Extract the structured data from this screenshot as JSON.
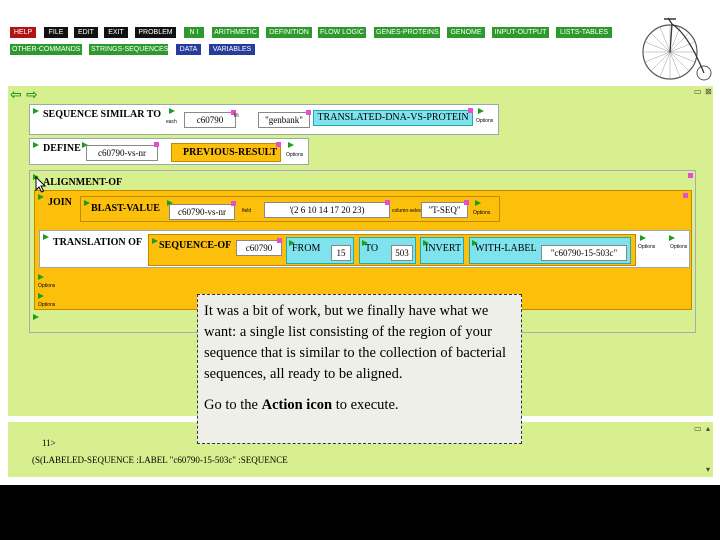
{
  "menu": {
    "row1": [
      {
        "label": "HELP",
        "color": "red"
      },
      {
        "label": "FILE",
        "color": "blk"
      },
      {
        "label": "EDIT",
        "color": "blk"
      },
      {
        "label": "EXIT",
        "color": "blk"
      },
      {
        "label": "PROBLEM",
        "color": "blk"
      },
      {
        "label": "N I",
        "color": "grn"
      },
      {
        "label": "ARITHMETIC",
        "color": "grn"
      },
      {
        "label": "DEFINITION",
        "color": "grn"
      },
      {
        "label": "FLOW LOGIC",
        "color": "grn"
      },
      {
        "label": "GENES-PROTEINS",
        "color": "grn"
      },
      {
        "label": "GENOME",
        "color": "grn"
      },
      {
        "label": "INPUT-OUTPUT",
        "color": "grn"
      },
      {
        "label": "LISTS-TABLES",
        "color": "grn"
      }
    ],
    "row2": [
      {
        "label": "OTHER-COMMANDS",
        "color": "grn"
      },
      {
        "label": "STRINGS-SEQUENCES",
        "color": "grn"
      },
      {
        "label": "DATA",
        "color": "blu"
      },
      {
        "label": "VARIABLES",
        "color": "blu"
      }
    ]
  },
  "workspace": {
    "seq_similar": {
      "keyword": "SEQUENCE SIMILAR TO",
      "arg1": "c60790",
      "label_each": "each",
      "label_in": "in",
      "arg2": "\"genbank\"",
      "arg3": "TRANSLATED-DNA-VS-PROTEIN",
      "options": "Options"
    },
    "define": {
      "keyword": "DEFINE",
      "arg1": "c60790-vs-nr",
      "arg2": "PREVIOUS-RESULT",
      "options": "Options"
    },
    "alignment": {
      "keyword": "ALIGNMENT-OF",
      "join": {
        "keyword": "JOIN",
        "blast_keyword": "BLAST-VALUE",
        "blast_arg": "c60790-vs-nr",
        "label_field": "field",
        "list_arg": "'(2 6 10 14 17 20 23)",
        "label_column": "column-selected",
        "tseq_arg": "\"T-SEQ\"",
        "options": "Options"
      },
      "translation": {
        "keyword": "TRANSLATION OF",
        "seqof_keyword": "SEQUENCE-OF",
        "seq_arg": "c60790",
        "from_label": "FROM",
        "from_val": "15",
        "to_label": "TO",
        "to_val": "503",
        "invert_label": "INVERT",
        "withlabel_label": "WITH-LABEL",
        "label_val": "\"c60790-15-503c\"",
        "options": "Options"
      },
      "options1": "Options",
      "options2": "Options",
      "options3": "Options"
    }
  },
  "tooltip": {
    "para1": "It was a bit of work, but we finally have what we want: a single list consisting of the region of your sequence that is similar to the collection of bacterial sequences, all ready to be aligned.",
    "para2_prefix": "Go to the ",
    "para2_bold": "Action icon",
    "para2_suffix": " to execute."
  },
  "history": {
    "line1": "11>",
    "line2": "(S(LABELED-SEQUENCE :LABEL \"c60790-15-503c\" :SEQUENCE"
  },
  "colors": {
    "workspace_bg": "#d7ef8e",
    "orange": "#fbbf0c",
    "cyan": "#7fe3ee",
    "menu_red": "#b01414",
    "menu_green": "#2e9a2e",
    "menu_blue": "#283c9c"
  }
}
